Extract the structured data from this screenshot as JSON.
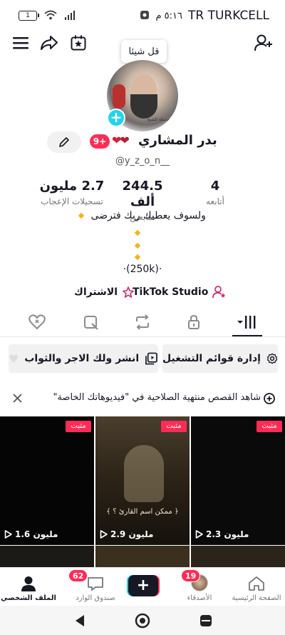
{
  "status_bar": {
    "battery": "1",
    "time": "٥:١٦ م",
    "carrier": "TR TURKCELL"
  },
  "profile": {
    "tooltip": "قل شيئا",
    "avatar_caption": "فضيلة الشيخ",
    "display_name": "بدر المشاري",
    "badge": "9+",
    "username": "@y_z_o_n__",
    "stats": [
      {
        "value": "4",
        "label": "أتابعه"
      },
      {
        "value": "244.5 ألف",
        "label": "متابعين"
      },
      {
        "value": "2.7 مليون",
        "label": "تسجيلات الإعجاب"
      }
    ],
    "bio_line1": "ولسوف يعطيك ربك فترضى",
    "bio_line3": "·(250k)·",
    "studio_link": "TikTok Studio",
    "subscribe_link": "الاشتراك"
  },
  "actions": {
    "playlists": "إدارة قوائم التشغيل",
    "share": "انشر ولك الاجر والثواب"
  },
  "notice": {
    "text": "شاهد القصص منتهية الصلاحية في \"فيديوهاتك الخاصة\""
  },
  "videos": [
    {
      "views": "2.3 مليون",
      "pinned": "مثبت"
    },
    {
      "views": "2.9 مليون",
      "pinned": "مثبت",
      "caption": "﴿ ممكن اسم القارئ ؟ ﴾"
    },
    {
      "views": "1.6 مليون",
      "pinned": "مثبت"
    }
  ],
  "bottom_nav": {
    "home": "الصفحة الرئيسية",
    "friends": "الأصدقاء",
    "friends_count": "19",
    "inbox": "صندوق الوارد",
    "inbox_count": "62",
    "profile": "الملف الشخصي"
  },
  "colors": {
    "accent": "#fe2c55",
    "cyan": "#20d5ec"
  }
}
